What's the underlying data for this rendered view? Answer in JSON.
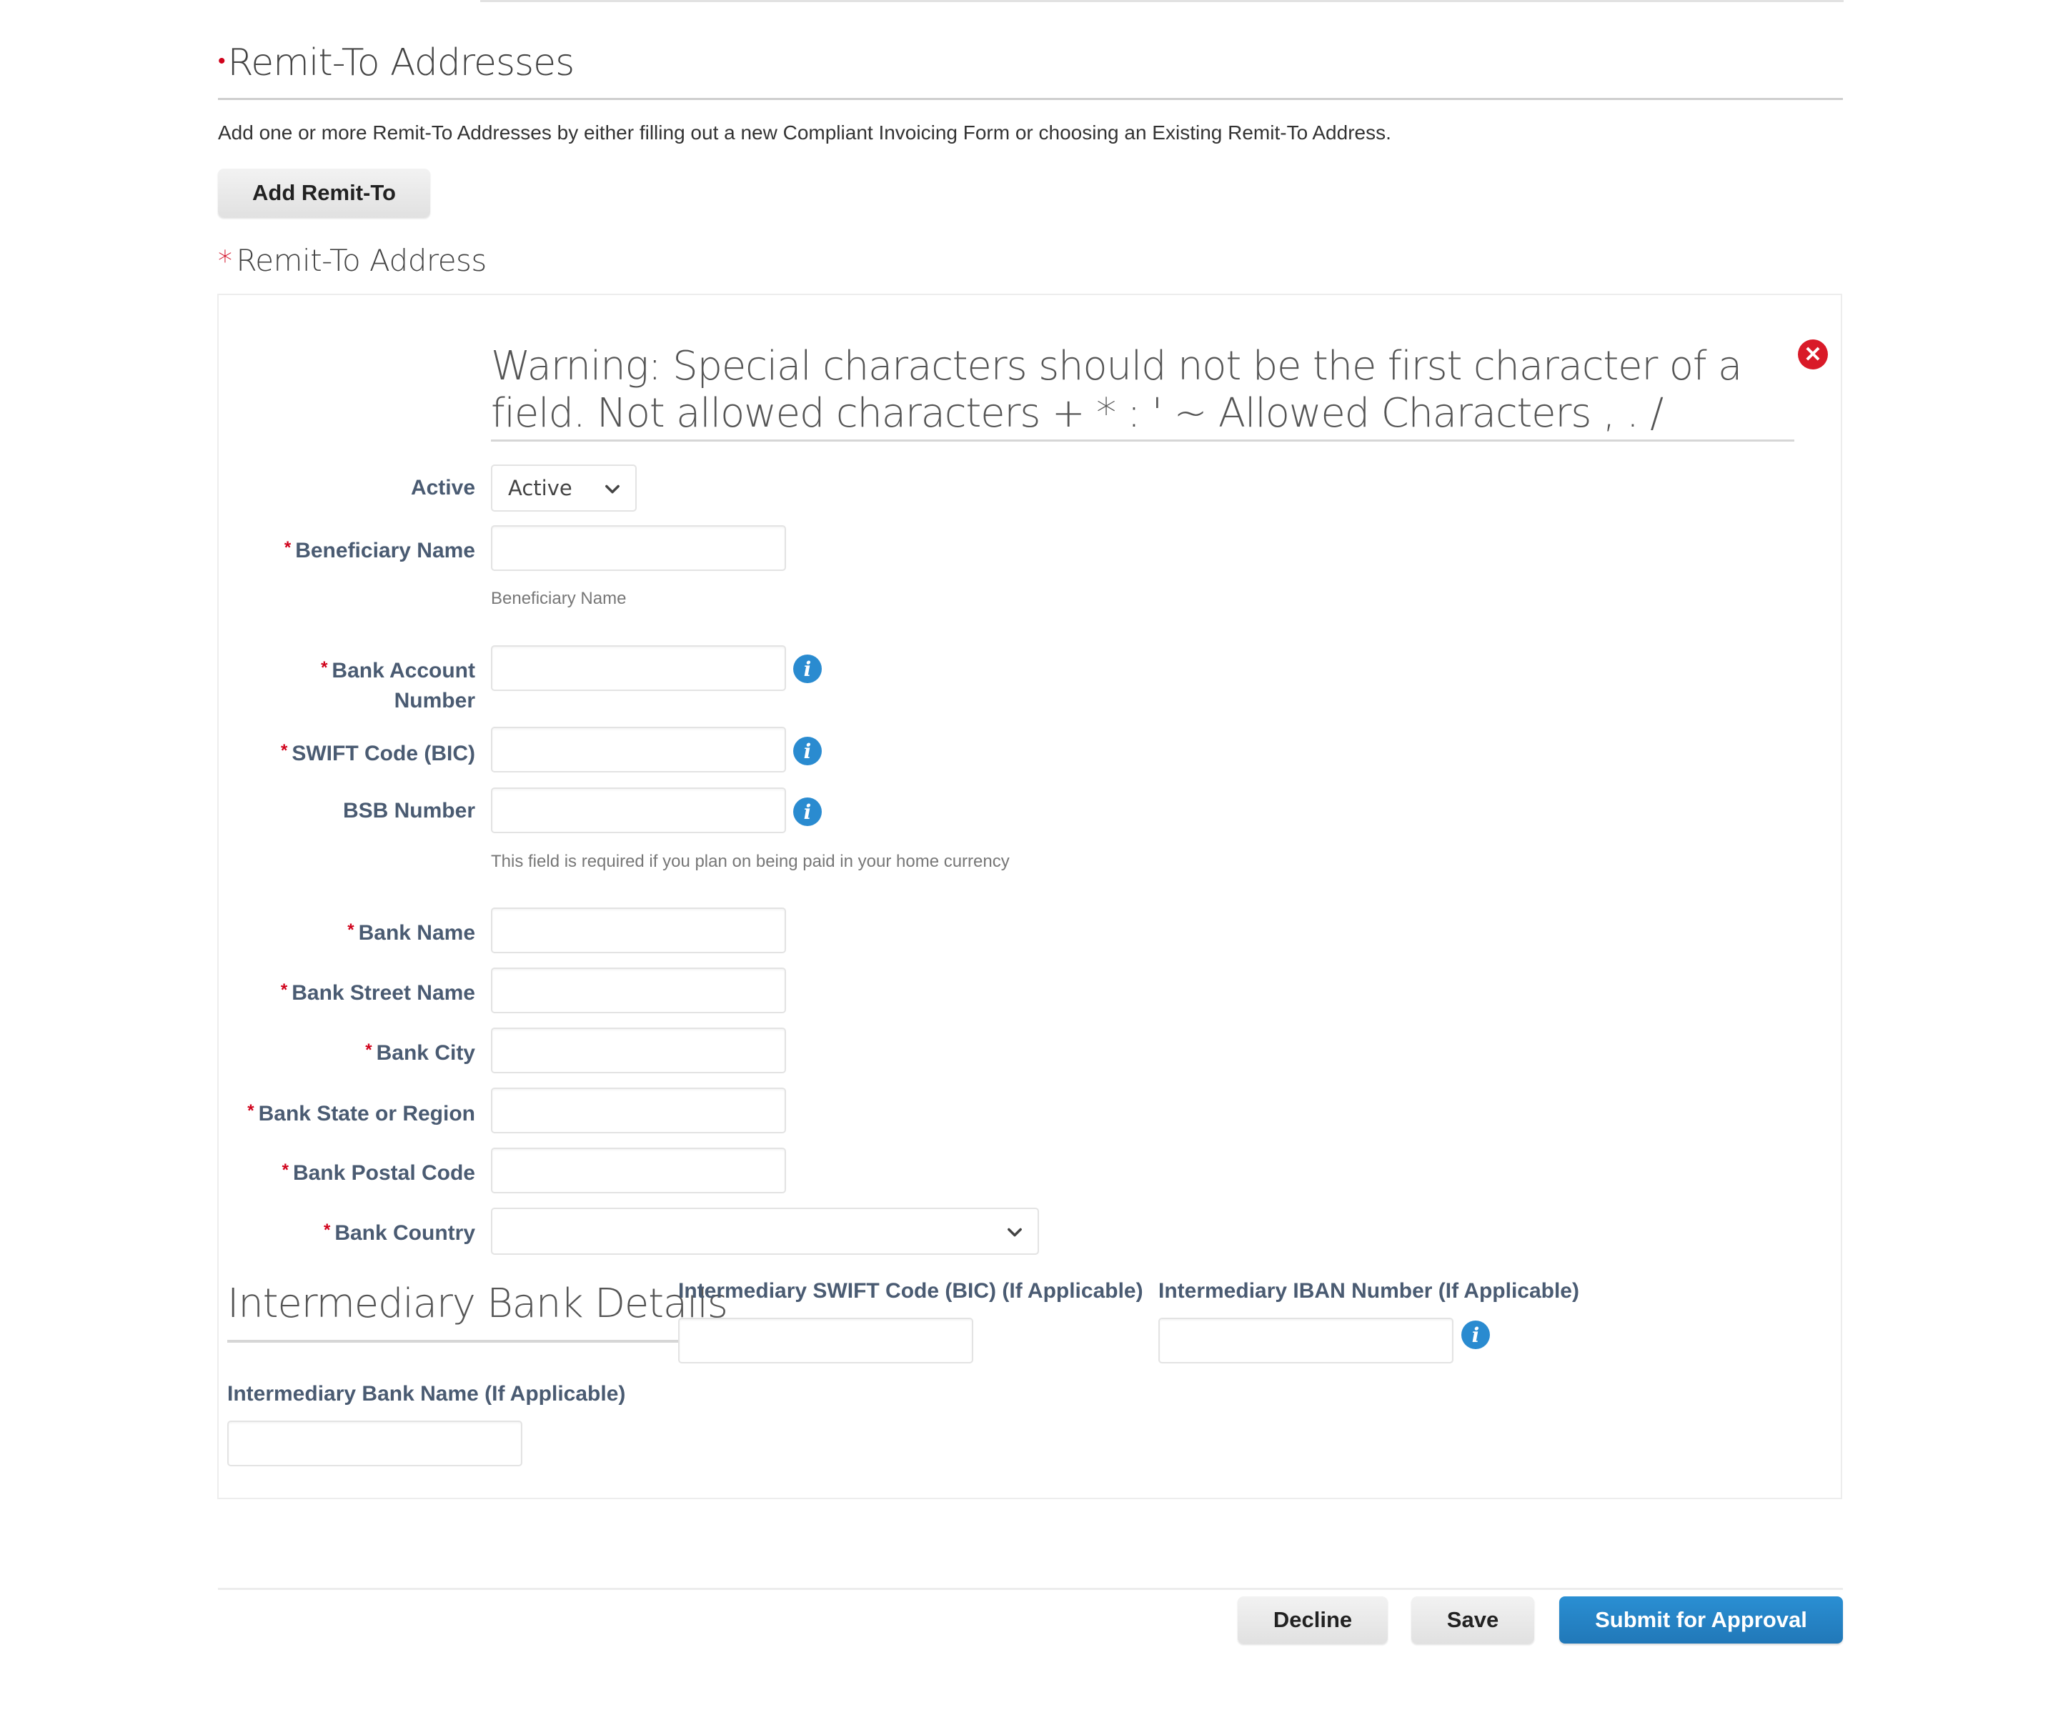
{
  "section": {
    "title": "Remit-To Addresses",
    "description": "Add one or more Remit-To Addresses by either filling out a new Compliant Invoicing Form or choosing an Existing Remit-To Address.",
    "add_button": "Add Remit-To",
    "subsection_title": "Remit-To Address",
    "required_mark": "*"
  },
  "warning": {
    "text": "Warning: Special characters should not be the first character of a field. Not allowed characters + * : ' ~ Allowed Characters , . /",
    "close_icon": "close-circle-icon"
  },
  "form": {
    "active": {
      "label": "Active",
      "value": "Active"
    },
    "beneficiary_name": {
      "label": "Beneficiary Name",
      "required": true,
      "value": "",
      "helper": "Beneficiary Name"
    },
    "bank_account_number": {
      "label_line1": "Bank Account",
      "label_line2": "Number",
      "required": true,
      "value": "",
      "info_icon": "info-icon"
    },
    "swift_code": {
      "label": "SWIFT Code (BIC)",
      "required": true,
      "value": "",
      "info_icon": "info-icon"
    },
    "bsb_number": {
      "label": "BSB Number",
      "required": false,
      "value": "",
      "info_icon": "info-icon",
      "helper": "This field is required if you plan on being paid in your home currency"
    },
    "bank_name": {
      "label": "Bank Name",
      "required": true,
      "value": ""
    },
    "bank_street_name": {
      "label": "Bank Street Name",
      "required": true,
      "value": ""
    },
    "bank_city": {
      "label": "Bank City",
      "required": true,
      "value": ""
    },
    "bank_state": {
      "label": "Bank State or Region",
      "required": true,
      "value": ""
    },
    "bank_postal_code": {
      "label": "Bank Postal Code",
      "required": true,
      "value": ""
    },
    "bank_country": {
      "label": "Bank Country",
      "required": true,
      "value": ""
    }
  },
  "intermediary": {
    "title": "Intermediary Bank Details",
    "swift_label": "Intermediary SWIFT Code (BIC) (If Applicable)",
    "iban_label": "Intermediary IBAN Number (If Applicable)",
    "bank_name_label": "Intermediary Bank Name (If Applicable)",
    "swift_value": "",
    "iban_value": "",
    "bank_name_value": ""
  },
  "footer": {
    "decline": "Decline",
    "save": "Save",
    "submit": "Submit for Approval"
  },
  "colors": {
    "required": "#d0021b",
    "label": "#4a5b72",
    "primary_button": "#2584c6",
    "info_icon": "#2a8bd0",
    "close_icon": "#d91a28"
  }
}
